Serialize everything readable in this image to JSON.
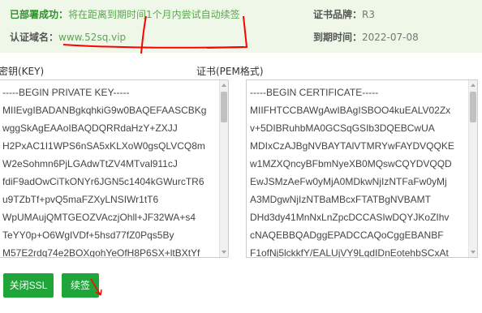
{
  "banner": {
    "deploy_label": "已部署成功：",
    "deploy_msg": "将在距离到期时间1个月内尝试自动续签",
    "domain_label": "认证域名：",
    "domain_value": "www.52sq.vip",
    "brand_label": "证书品牌：",
    "brand_value": "R3",
    "expire_label": "到期时间：",
    "expire_value": "2022-07-08"
  },
  "key_section": {
    "title": "密钥(KEY)",
    "lines": [
      "-----BEGIN PRIVATE KEY-----",
      "MIIEvgIBADANBgkqhkiG9w0BAQEFAASCBKg",
      "wggSkAgEAAoIBAQDQRRdaHzY+ZXJJ",
      "H2PxAC1I1WPS6nSA5xKLXoW0gsQLVCQ8m",
      "W2eSohmn6PjLGAdwTtZV4MTval911cJ",
      "fdiF9adOwCiTkONYr6JGN5c1404kGWurcTR6",
      "u9TZbTf+pvQ5maFZXyLNSIWr1tT6",
      "WpUMAujQMTGEOZVAczjOhll+JF32WA+s4",
      "TeYY0p+O6WgIVDf+5hsd77fZ0Pqs5By",
      "M57E2rdq74e2BOXgohYeOfH8P6SX+ltBXtYf"
    ]
  },
  "cert_section": {
    "title": "证书(PEM格式)",
    "lines": [
      "-----BEGIN CERTIFICATE-----",
      "MIIFHTCCBAWgAwIBAgISBOO4kuEALV02Zx",
      "v+5DIBRuhbMA0GCSqGSIb3DQEBCwUA",
      "MDIxCzAJBgNVBAYTAlVTMRYwFAYDVQQKE",
      "w1MZXQncyBFbmNyeXB0MQswCQYDVQQD",
      "EwJSMzAeFw0yMjA0MDkwNjIzNTFaFw0yMj",
      "A3MDgwNjIzNTBaMBcxFTATBgNVBAMT",
      "DHd3dy41MnNxLnZpcDCCASIwDQYJKoZIhv",
      "cNAQEBBQADggEPADCCAQoCggEBANBF",
      "F1ofNj5lckkfY/EALUjVY9LqdIDnEotehbSCxAt"
    ]
  },
  "buttons": {
    "close_ssl": "关闭SSL",
    "renew": "续签"
  },
  "colors": {
    "accent_green": "#20a53a",
    "banner_bg": "#eef7e8",
    "annotation_red": "#ff0000"
  }
}
